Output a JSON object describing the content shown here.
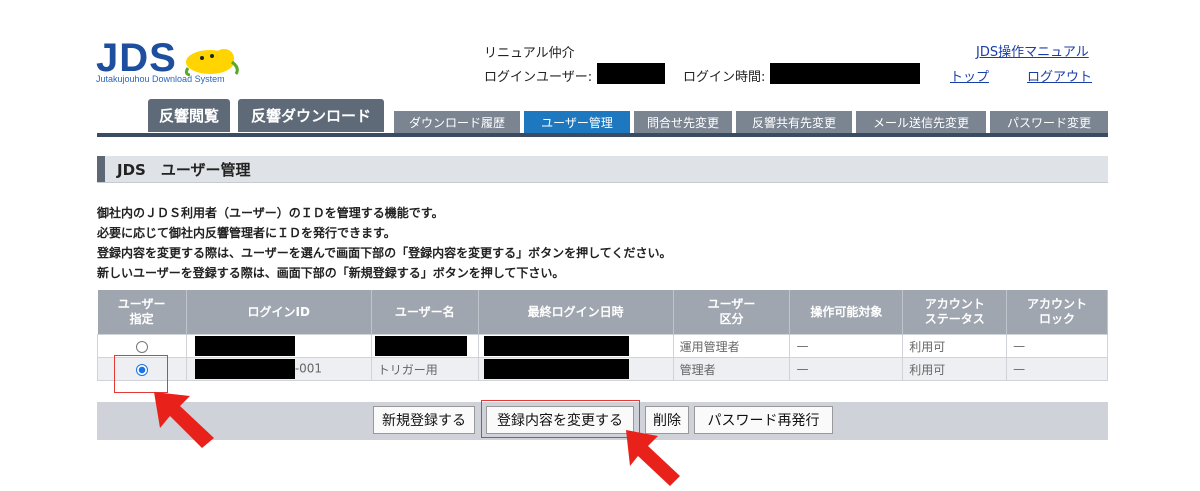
{
  "logo": {
    "title": "JDS",
    "subtitle": "Jutakujouhou Download System"
  },
  "header": {
    "company": "リニュアル仲介",
    "login_user_label": "ログインユーザー:",
    "login_time_label": "ログイン時間:",
    "manual_link": "JDS操作マニュアル",
    "top_link": "トップ",
    "logout_link": "ログアウト"
  },
  "tabs": {
    "main": [
      "反響閲覧",
      "反響ダウンロード"
    ],
    "sub": [
      "ダウンロード履歴",
      "ユーザー管理",
      "問合せ先変更",
      "反響共有先変更",
      "メール送信先変更",
      "パスワード変更"
    ],
    "active_sub": "ユーザー管理"
  },
  "section_title": "JDS　ユーザー管理",
  "description": [
    "御社内のＪＤＳ利用者（ユーザー）のＩＤを管理する機能です。",
    "必要に応じて御社内反響管理者にＩＤを発行できます。",
    "登録内容を変更する際は、ユーザーを選んで画面下部の「登録内容を変更する」ボタンを押してください。",
    "新しいユーザーを登録する際は、画面下部の「新規登録する」ボタンを押して下さい。"
  ],
  "table": {
    "headers": [
      "ユーザー\n指定",
      "ログインID",
      "ユーザー名",
      "最終ログイン日時",
      "ユーザー\n区分",
      "操作可能対象",
      "アカウント\nステータス",
      "アカウント\nロック"
    ],
    "rows": [
      {
        "selected": false,
        "login_id_suffix": "",
        "user_name": "",
        "last_login": "",
        "user_type": "運用管理者",
        "target": "—",
        "status": "利用可",
        "lock": "—"
      },
      {
        "selected": true,
        "login_id_suffix": "-001",
        "user_name": "トリガー用",
        "last_login": "",
        "user_type": "管理者",
        "target": "—",
        "status": "利用可",
        "lock": "—"
      }
    ]
  },
  "buttons": {
    "new": "新規登録する",
    "edit": "登録内容を変更する",
    "delete": "削除",
    "reissue": "パスワード再発行"
  },
  "colors": {
    "brand": "#1d4f9e",
    "tab_active": "#1e78bf",
    "tab_dark": "#5f6a78",
    "highlight": "#e53935"
  }
}
